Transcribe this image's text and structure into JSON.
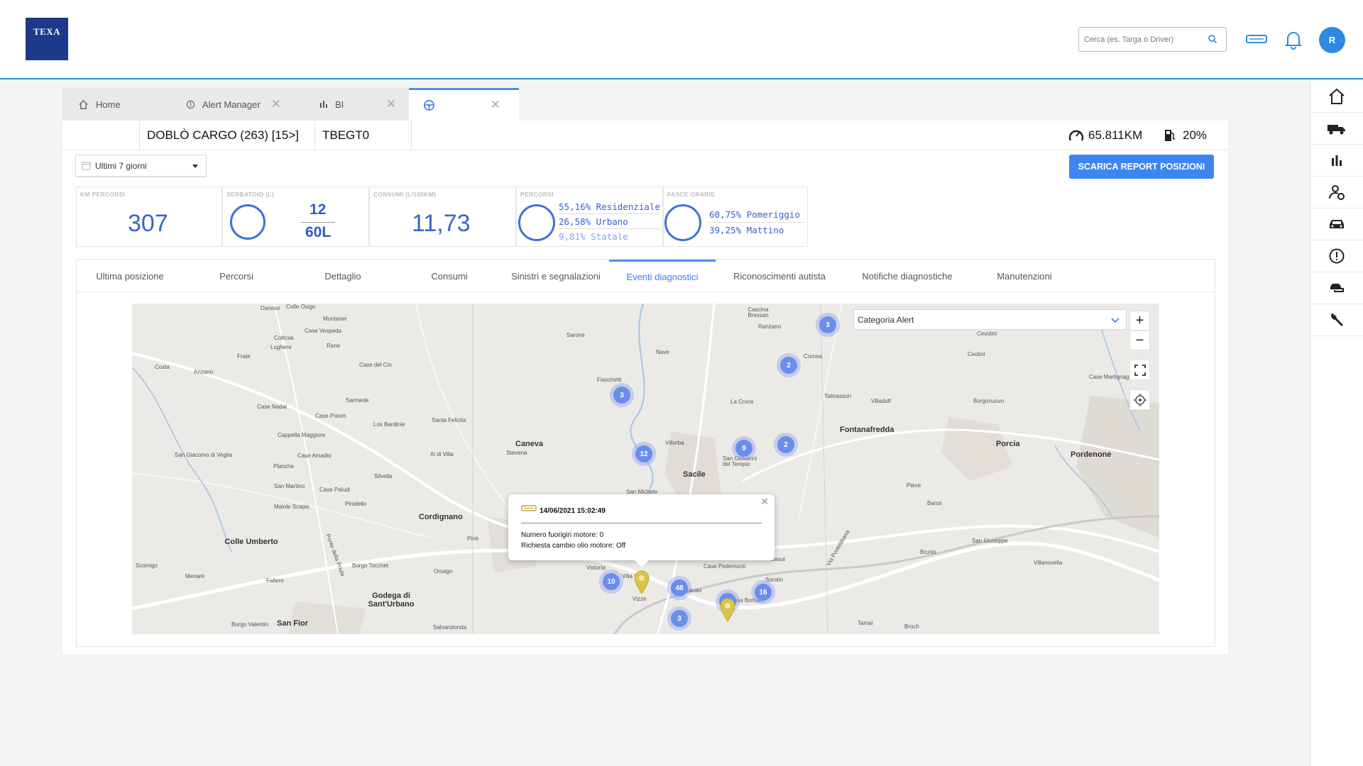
{
  "brand": {
    "logo_text": "TEXA"
  },
  "header": {
    "search_placeholder": "Cerca (es. Targa o Driver)",
    "avatar_initial": "R"
  },
  "tabs": [
    {
      "label": "Home",
      "icon": "home-icon",
      "closable": false
    },
    {
      "label": "Alert Manager",
      "icon": "alert-circle-icon",
      "closable": true
    },
    {
      "label": "BI",
      "icon": "bar-chart-icon",
      "closable": true
    },
    {
      "label": "",
      "icon": "steering-wheel-icon",
      "closable": true,
      "active": true
    }
  ],
  "vehicle": {
    "name": "DOBLÒ CARGO (263) [15>]",
    "plate": "TBEGT0",
    "odometer": "65.811KM",
    "fuel": "20%"
  },
  "filters": {
    "period": "Ultimi 7 giorni"
  },
  "actions": {
    "report_button": "SCARICA REPORT POSIZIONI"
  },
  "kpis": {
    "km": {
      "title": "KM PERCORSI",
      "value": "307"
    },
    "tank": {
      "title": "SERBATOIO (L)",
      "current": "12",
      "capacity": "60L"
    },
    "consumption": {
      "title": "CONSUMI (L/100KM)",
      "value": "11,73"
    },
    "routes": {
      "title": "PERCORSI",
      "lines": [
        "55,16% Residenziale",
        "26,58% Urbano",
        "9,81% Statale"
      ]
    },
    "hours": {
      "title": "FASCE ORARIE",
      "lines": [
        "60,75% Pomeriggio",
        "39,25% Mattino"
      ]
    }
  },
  "subtabs": [
    "Ultima posizione",
    "Percorsi",
    "Dettaglio",
    "Consumi",
    "Sinistri e segnalazioni",
    "Eventi diagnostici",
    "Riconoscimenti autista",
    "Notifiche diagnostiche",
    "Manutenzioni"
  ],
  "active_subtab": "Eventi diagnostici",
  "map": {
    "category_placeholder": "Categoria Alert",
    "zoom_in": "+",
    "zoom_out": "−",
    "places": [
      "Danese",
      "Colle Osigo",
      "Montaner",
      "Case Vespeda",
      "Coltrola",
      "Lughera",
      "Rane",
      "Frate",
      "Costa",
      "Anzano",
      "Case del Cin",
      "Sarmede",
      "Case Nadal",
      "Case Polom",
      "Los Bardinie",
      "Santa Felicita",
      "Cappella Maggiore",
      "Case Amadio",
      "Ai di Villa",
      "San Giacomo di Veglia",
      "Planche",
      "Silvella",
      "San Martino",
      "Case Paludi",
      "Pinidello",
      "Maiole Scapis",
      "Colle Umberto",
      "Scomigo",
      "Menarè",
      "Fallero",
      "Ponte della Priula",
      "Orsago",
      "Borgo Tocchet",
      "Godega di Sant'Urbano",
      "Borgo Valentin",
      "San Fior",
      "Salvarotonda",
      "Pinè",
      "Cordignano",
      "Caneva",
      "Stevena",
      "Sarone",
      "Fiaschetti",
      "Nave",
      "Villorba",
      "La Croce",
      "Sacile",
      "San Giovanni del Tempio",
      "San Michele",
      "Cornea",
      "Cascina Bressan",
      "Ranzano",
      "Talmasson",
      "Villadolt",
      "Fontanafredda",
      "Borgonuovo",
      "Case Martignagh",
      "Cevolini",
      "Ceolini",
      "Porcia",
      "Pordenone",
      "Pieve",
      "Baros",
      "San Giuseppe",
      "Villanovella",
      "Brunis",
      "Vizze",
      "Case Pedemonti",
      "Casut",
      "Casa Bortolin",
      "Tamai",
      "Broch",
      "Vistorta",
      "Villa Varda",
      "Sorolin",
      "Ravarolo",
      "Via Pontebbana"
    ],
    "clusters": [
      "3",
      "2",
      "3",
      "12",
      "9",
      "2",
      "10",
      "48",
      "3",
      "14",
      "16"
    ],
    "popup": {
      "datetime": "14/06/2021 15:02:49",
      "lines": [
        "Numero fuorigiri motore: 0",
        "Richiesta cambio olio motore: Off"
      ]
    }
  },
  "sidebar": {
    "items": [
      "home-icon",
      "truck-icon",
      "bar-chart-icon",
      "driver-icon",
      "car-icon",
      "alert-circle-icon",
      "vehicle-transfer-icon",
      "wrench-icon"
    ]
  },
  "colors": {
    "accent": "#3d86f2",
    "brand": "#1d3a8a",
    "cluster": "#6b8eeb",
    "pin": "#d9c34a"
  }
}
